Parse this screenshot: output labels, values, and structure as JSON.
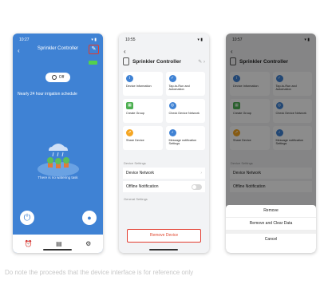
{
  "screen1": {
    "time": "10:27",
    "signal": "▾ ▮",
    "title": "Sprinkler Controller",
    "off_label": "Off",
    "schedule": "Nearly 24 hour irrigation schedule",
    "no_watering": "There is no watering task",
    "tabs": [
      "⏰",
      "▤",
      "⚙"
    ]
  },
  "screen2": {
    "time": "10:55",
    "title": "Sprinkler Controller",
    "cards": [
      {
        "label": "Device Information",
        "icon": "info-icon",
        "color": "#3f82d4"
      },
      {
        "label": "Tap-to-Run and Automation",
        "icon": "check-icon",
        "color": "#3f82d4"
      },
      {
        "label": "Create Group",
        "icon": "group-icon",
        "color": "#4caf50"
      },
      {
        "label": "Check Device Network",
        "icon": "network-icon",
        "color": "#3f82d4"
      },
      {
        "label": "Share Device",
        "icon": "share-icon",
        "color": "#f5a623"
      },
      {
        "label": "Message notification Settings",
        "icon": "bell-icon",
        "color": "#3f82d4"
      }
    ],
    "device_settings_header": "Device Settings",
    "device_network": "Device Network",
    "offline_notification": "Offline Notification",
    "general_settings_header": "General Settings",
    "remove_device": "Remove Device"
  },
  "screen3": {
    "time": "10:57",
    "title": "Sprinkler Controller",
    "device_settings_header": "Device Settings",
    "device_network": "Device Network",
    "offline_notification": "Offline Notification",
    "sheet": {
      "remove": "Remove",
      "remove_clear": "Remove and Clear Data",
      "cancel": "Cancel"
    }
  },
  "caption": "Do note the proceeds that the device interface is for reference only"
}
